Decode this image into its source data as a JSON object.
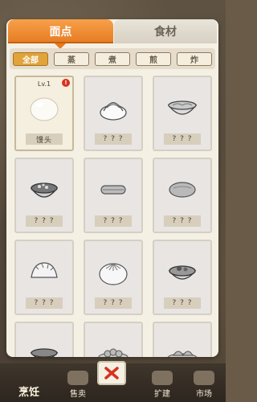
{
  "tabs": {
    "active": "面点",
    "inactive": "食材"
  },
  "filters": [
    "全部",
    "蒸",
    "煮",
    "煎",
    "炸"
  ],
  "items": [
    {
      "level": "Lv.1",
      "name": "馒头",
      "food": "mantou-icon",
      "unlocked": true,
      "new": true,
      "new_mark": "!"
    },
    {
      "name": "? ? ?",
      "food": "swirl-bun-icon",
      "unlocked": false
    },
    {
      "name": "? ? ?",
      "food": "noodle-bowl-icon",
      "unlocked": false
    },
    {
      "name": "? ? ?",
      "food": "rice-bowl-icon",
      "unlocked": false
    },
    {
      "name": "? ? ?",
      "food": "fried-dough-stick-icon",
      "unlocked": false
    },
    {
      "name": "? ? ?",
      "food": "flatbread-icon",
      "unlocked": false
    },
    {
      "name": "? ? ?",
      "food": "dumpling-icon",
      "unlocked": false
    },
    {
      "name": "? ? ?",
      "food": "baozi-icon",
      "unlocked": false
    },
    {
      "name": "? ? ?",
      "food": "soup-bowl-icon",
      "unlocked": false
    },
    {
      "name": "",
      "food": "bowl-icon",
      "unlocked": false
    },
    {
      "name": "",
      "food": "pastry-plate-icon",
      "unlocked": false
    },
    {
      "name": "",
      "food": "wonton-plate-icon",
      "unlocked": false
    }
  ],
  "bottom_nav": {
    "cook": "烹饪",
    "sell": "售卖",
    "expand": "扩建",
    "market": "市场"
  },
  "colors": {
    "accent": "#e67b22",
    "panel": "#f5f0e4",
    "close_x": "#d8321f"
  }
}
